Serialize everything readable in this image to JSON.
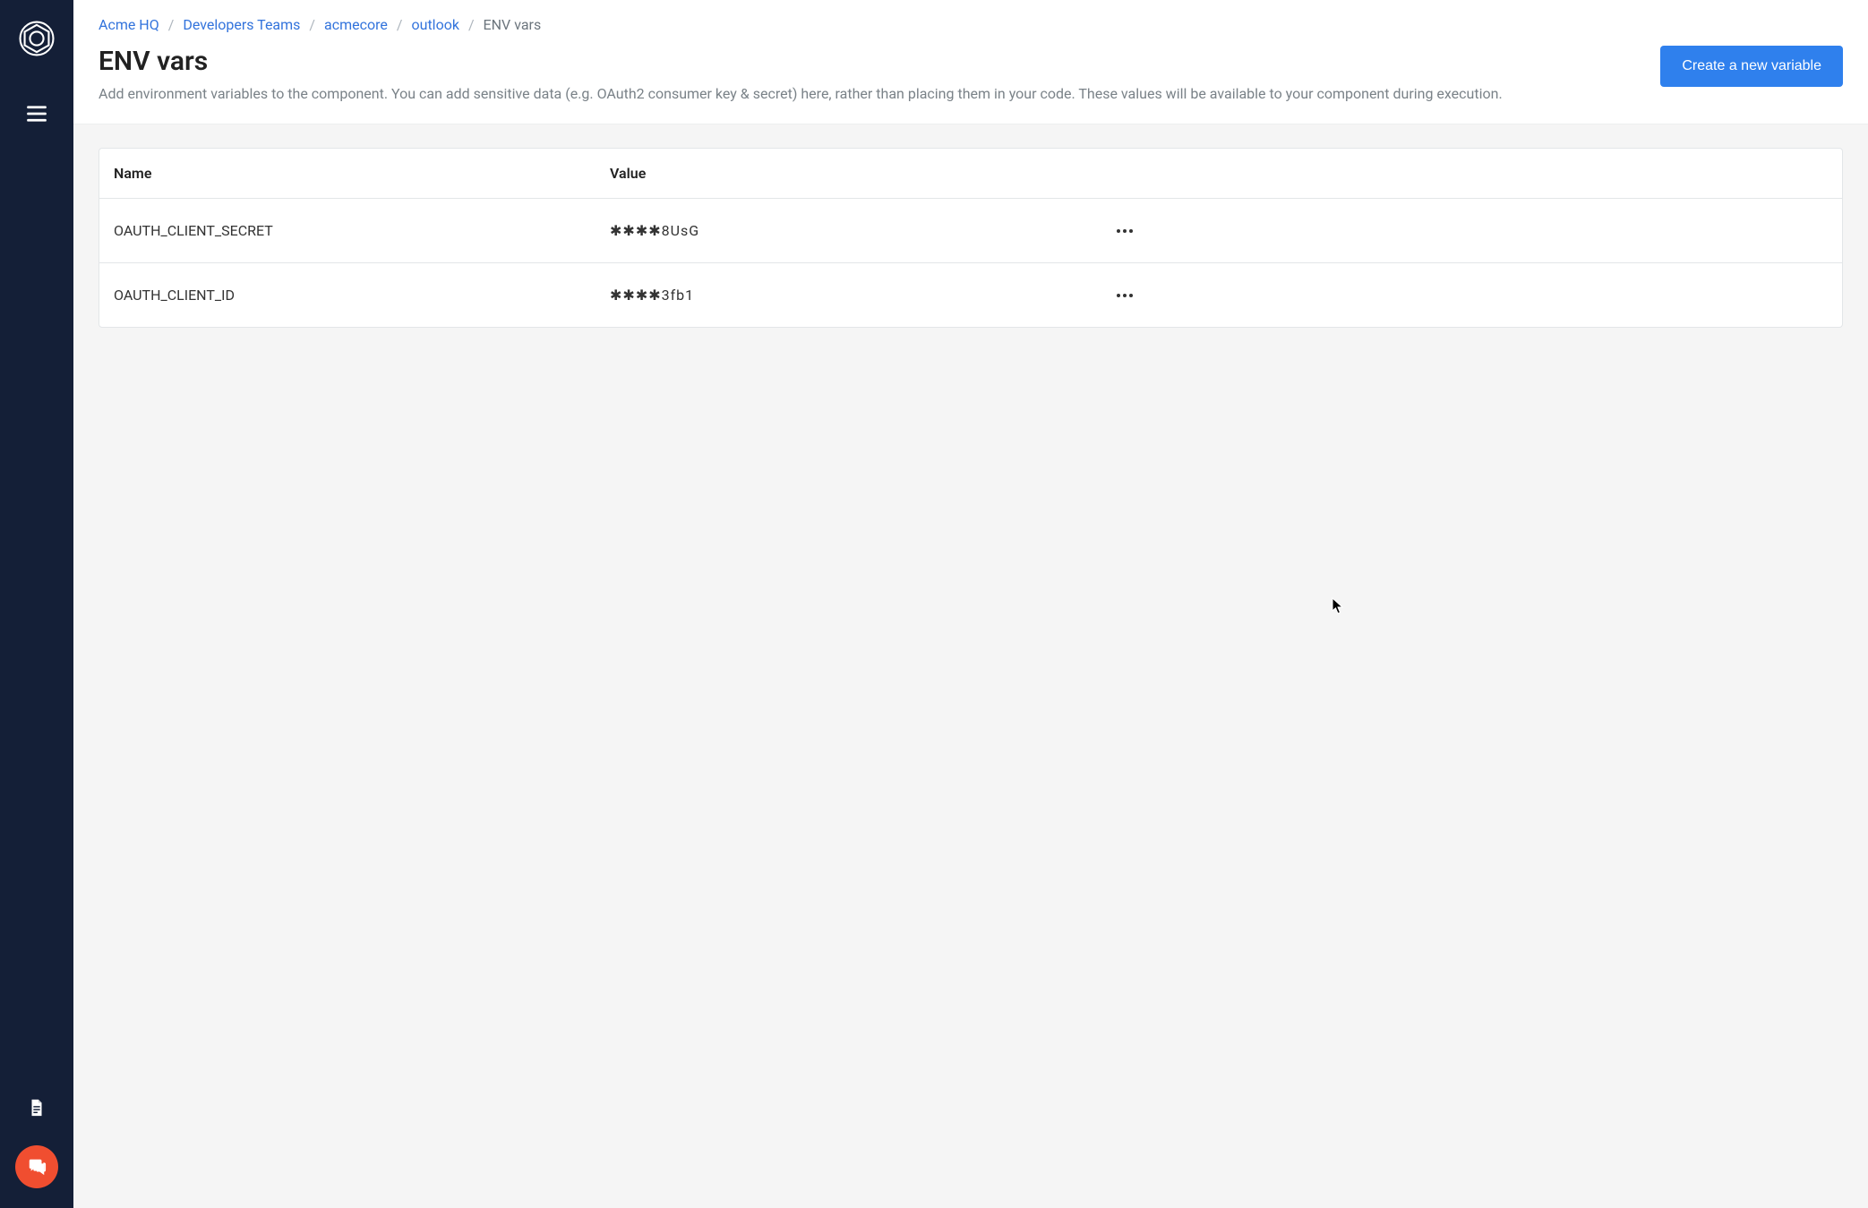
{
  "breadcrumb": {
    "items": [
      {
        "label": "Acme HQ"
      },
      {
        "label": "Developers Teams"
      },
      {
        "label": "acmecore"
      },
      {
        "label": "outlook"
      }
    ],
    "current": "ENV vars",
    "separator": "/"
  },
  "page": {
    "title": "ENV vars",
    "description": "Add environment variables to the component. You can add sensitive data (e.g. OAuth2 consumer key & secret) here, rather than placing them in your code. These values will be available to your component during execution.",
    "create_button": "Create a new variable"
  },
  "table": {
    "headers": {
      "name": "Name",
      "value": "Value"
    },
    "rows": [
      {
        "name": "OAUTH_CLIENT_SECRET",
        "value": "✱✱✱✱8UsG"
      },
      {
        "name": "OAUTH_CLIENT_ID",
        "value": "✱✱✱✱3fb1"
      }
    ]
  }
}
